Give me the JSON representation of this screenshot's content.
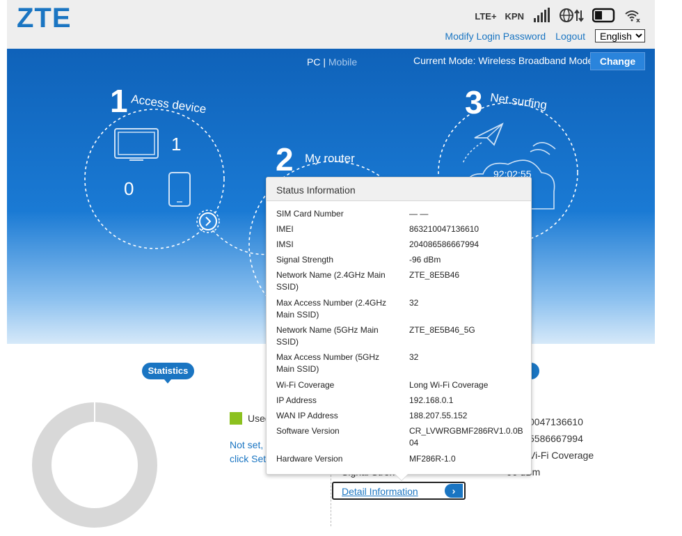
{
  "header": {
    "logo": "ZTE",
    "network_type": "LTE+",
    "operator": "KPN",
    "icons": [
      "signal-bars-icon",
      "globe-data-icon",
      "battery-icon",
      "wifi-off-icon"
    ],
    "links": {
      "modify_password": "Modify Login Password",
      "logout": "Logout"
    },
    "language": {
      "selected": "English",
      "options": [
        "English"
      ]
    }
  },
  "banner": {
    "view_pc": "PC",
    "view_sep": "|",
    "view_mobile": "Mobile",
    "current_mode": "Current Mode: Wireless Broadband Mode",
    "change_label": "Change",
    "step1": {
      "num": "1",
      "label": "Access device",
      "wired_count": "1",
      "wireless_count": "0"
    },
    "step2": {
      "num": "2",
      "label": "My router"
    },
    "step3": {
      "num": "3",
      "label": "Net surfing",
      "time": "92:02:55"
    }
  },
  "statistics": {
    "badge": "Statistics",
    "used_label": "Used",
    "not_set_line1": "Not set,",
    "not_set_line2": "click Sett"
  },
  "background_info": {
    "imei_partial": "0047136610",
    "imsi_partial": "5586667994",
    "coverage_partial": "Vi-Fi Coverage",
    "signal_label_partial": "Signal Stren",
    "signal_value_partial": "96 dBm",
    "detail_button": "Detail Information"
  },
  "popup": {
    "title": "Status Information",
    "rows": [
      {
        "key": "SIM Card Number",
        "value": "— —"
      },
      {
        "key": "IMEI",
        "value": "863210047136610"
      },
      {
        "key": "IMSI",
        "value": "204086586667994"
      },
      {
        "key": "Signal Strength",
        "value": "-96 dBm"
      },
      {
        "key": "Network Name (2.4GHz Main SSID)",
        "value": "ZTE_8E5B46"
      },
      {
        "key": "Max Access Number (2.4GHz Main SSID)",
        "value": "32"
      },
      {
        "key": "Network Name (5GHz Main SSID)",
        "value": "ZTE_8E5B46_5G"
      },
      {
        "key": "Max Access Number (5GHz Main SSID)",
        "value": "32"
      },
      {
        "key": "Wi-Fi Coverage",
        "value": "Long Wi-Fi Coverage"
      },
      {
        "key": "IP Address",
        "value": "192.168.0.1"
      },
      {
        "key": "WAN IP Address",
        "value": "188.207.55.152"
      },
      {
        "key": "Software Version",
        "value": "CR_LVWRGBMF286RV1.0.0B04"
      },
      {
        "key": "Hardware Version",
        "value": "MF286R-1.0"
      }
    ]
  }
}
